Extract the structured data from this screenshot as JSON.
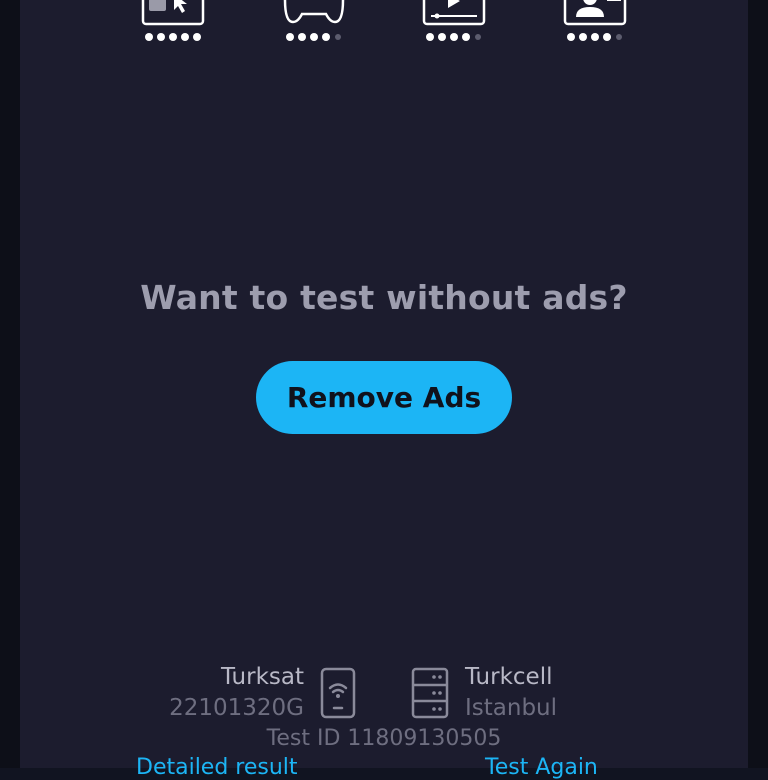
{
  "ratings": [
    {
      "name": "browsing",
      "icon": "browser-cursor-icon",
      "filled": 5,
      "total": 5
    },
    {
      "name": "gaming",
      "icon": "gamepad-icon",
      "filled": 4,
      "total": 5
    },
    {
      "name": "streaming",
      "icon": "video-player-icon",
      "filled": 4,
      "total": 5
    },
    {
      "name": "video-calling",
      "icon": "video-call-icon",
      "filled": 4,
      "total": 5
    }
  ],
  "promo": {
    "question": "Want to test without ads?",
    "button_label": "Remove Ads"
  },
  "connection": {
    "provider": "Turksat",
    "provider_id": "22101320G",
    "provider_icon": "wifi-phone-icon",
    "server": "Turkcell",
    "server_location": "Istanbul",
    "server_icon": "server-icon"
  },
  "test_id": "Test ID 11809130505",
  "links": {
    "detailed": "Detailed result",
    "again": "Test Again"
  },
  "colors": {
    "background": "#1c1c2e",
    "accent": "#1cb5f5",
    "text_primary": "#b8b8c6",
    "text_secondary": "#6e6e80",
    "dot_filled": "#ffffff",
    "dot_empty": "#5c5c6e"
  }
}
